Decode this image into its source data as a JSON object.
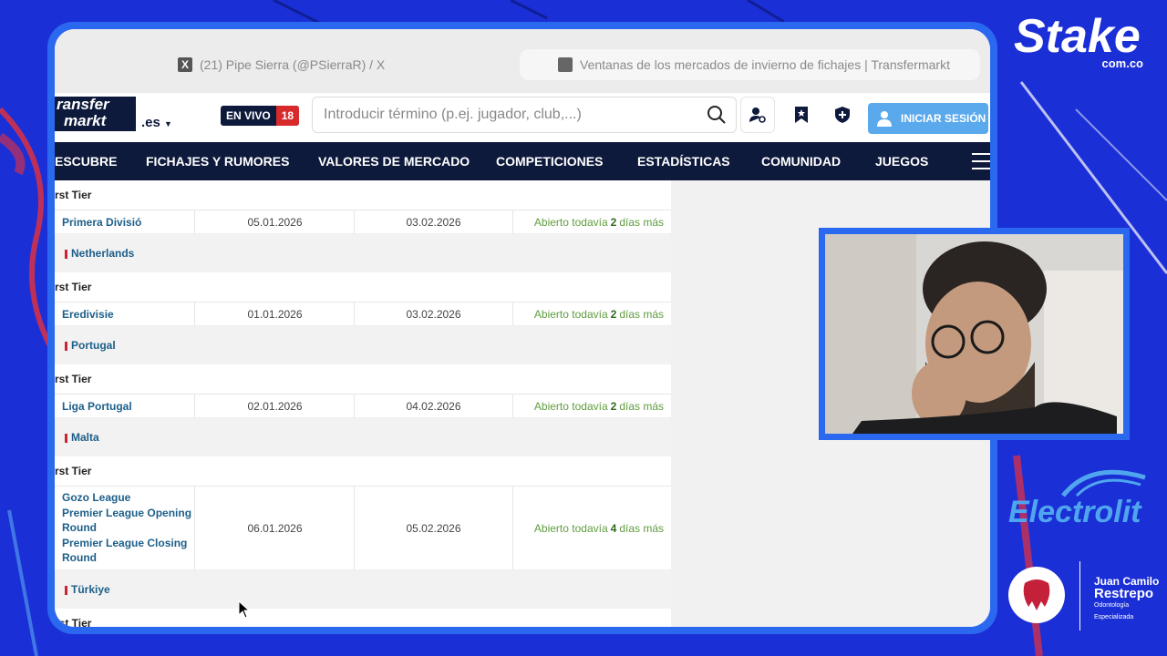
{
  "browser": {
    "tabs": [
      {
        "title": "(21) Pipe Sierra (@PSierraR) / X",
        "icon": "x-logo-icon"
      },
      {
        "title": "Ventanas de los mercados de invierno de fichajes | Transfermarkt",
        "icon": "transfermarkt-favicon-icon"
      }
    ]
  },
  "header": {
    "logo_line1": "ransfer",
    "logo_line2": "markt",
    "logo_tld": ".es",
    "live_label": "EN VIVO",
    "live_count": "18",
    "search_placeholder": "Introducir término (p.ej. jugador, club,...)",
    "login_label": "INICIAR SESIÓN"
  },
  "nav": {
    "items": [
      "ESCUBRE",
      "FICHAJES Y RUMORES",
      "VALORES DE MERCADO",
      "COMPETICIONES",
      "ESTADÍSTICAS",
      "COMUNIDAD",
      "JUEGOS"
    ]
  },
  "table": {
    "tier_label": "rst Tier",
    "open_prefix": "Abierto todavía",
    "days_suffix": "días más",
    "rows": [
      {
        "type": "tier"
      },
      {
        "type": "league",
        "leagues": [
          "Primera Divisió"
        ],
        "start": "05.01.2026",
        "end": "03.02.2026",
        "days": "2"
      },
      {
        "type": "country",
        "name": "Netherlands"
      },
      {
        "type": "tier"
      },
      {
        "type": "league",
        "leagues": [
          "Eredivisie"
        ],
        "start": "01.01.2026",
        "end": "03.02.2026",
        "days": "2"
      },
      {
        "type": "country",
        "name": "Portugal"
      },
      {
        "type": "tier"
      },
      {
        "type": "league",
        "leagues": [
          "Liga Portugal"
        ],
        "start": "02.01.2026",
        "end": "04.02.2026",
        "days": "2"
      },
      {
        "type": "country",
        "name": "Malta"
      },
      {
        "type": "tier"
      },
      {
        "type": "league",
        "leagues": [
          "Gozo League",
          "Premier League Opening Round",
          "Premier League Closing Round"
        ],
        "start": "06.01.2026",
        "end": "05.02.2026",
        "days": "4"
      },
      {
        "type": "country",
        "name": "Türkiye"
      },
      {
        "type": "tier"
      }
    ]
  },
  "overlay": {
    "stake_brand": "Stake",
    "stake_domain": "com.co",
    "electrolit_brand": "Electrolit",
    "sponsor_name_1": "Juan Camilo",
    "sponsor_name_2": "Restrepo",
    "sponsor_sub_1": "Odontología",
    "sponsor_sub_2": "Especializada"
  },
  "colors": {
    "stream_bg": "#1b2fd6",
    "frame_blue": "#2a68f0",
    "tm_navy": "#0e1a3c",
    "link_blue": "#1d5f8a",
    "open_green": "#5f9d3f",
    "login_blue": "#5aa9ec",
    "live_red": "#d82a2a"
  }
}
